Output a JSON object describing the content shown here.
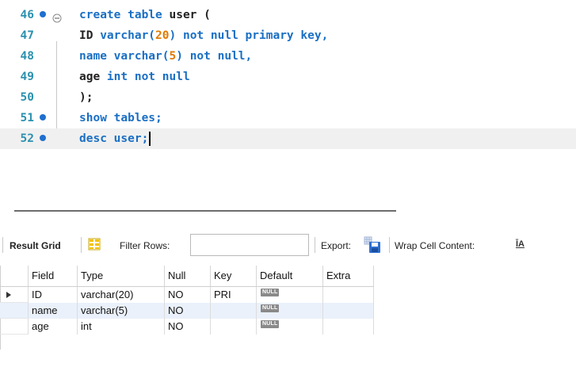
{
  "editor": {
    "lines": [
      {
        "num": "46",
        "dot": true,
        "fold": true,
        "tokens": [
          {
            "t": "create table",
            "c": "kw"
          },
          {
            "t": " user (",
            "c": "id"
          }
        ]
      },
      {
        "num": "47",
        "dot": false,
        "fold": false,
        "tokens": [
          {
            "t": "ID ",
            "c": "id"
          },
          {
            "t": "varchar(",
            "c": "kw"
          },
          {
            "t": "20",
            "c": "num"
          },
          {
            "t": ") not null primary key,",
            "c": "kw"
          }
        ]
      },
      {
        "num": "48",
        "dot": false,
        "fold": false,
        "tokens": [
          {
            "t": "name varchar(",
            "c": "kw"
          },
          {
            "t": "5",
            "c": "num"
          },
          {
            "t": ") not null,",
            "c": "kw"
          }
        ]
      },
      {
        "num": "49",
        "dot": false,
        "fold": false,
        "tokens": [
          {
            "t": "age ",
            "c": "id"
          },
          {
            "t": "int not null",
            "c": "kw"
          }
        ]
      },
      {
        "num": "50",
        "dot": false,
        "fold": false,
        "tokens": [
          {
            "t": ");",
            "c": "id"
          }
        ]
      },
      {
        "num": "51",
        "dot": true,
        "fold": false,
        "tokens": [
          {
            "t": "show tables;",
            "c": "kw"
          }
        ]
      },
      {
        "num": "52",
        "dot": true,
        "fold": false,
        "tokens": [
          {
            "t": "desc user;",
            "c": "kw"
          }
        ]
      }
    ]
  },
  "toolbar": {
    "result_grid_label": "Result Grid",
    "filter_rows_label": "Filter Rows:",
    "filter_value": "",
    "export_label": "Export:",
    "wrap_label": "Wrap Cell Content:",
    "wrap_icon_glyph": "ĪA"
  },
  "grid": {
    "columns": [
      "Field",
      "Type",
      "Null",
      "Key",
      "Default",
      "Extra"
    ],
    "null_badge": "NULL",
    "rows": [
      {
        "field": "ID",
        "type": "varchar(20)",
        "null": "NO",
        "key": "PRI",
        "default": "NULL",
        "extra": "",
        "current": true
      },
      {
        "field": "name",
        "type": "varchar(5)",
        "null": "NO",
        "key": "",
        "default": "NULL",
        "extra": "",
        "current": false
      },
      {
        "field": "age",
        "type": "int",
        "null": "NO",
        "key": "",
        "default": "NULL",
        "extra": "",
        "current": false
      }
    ]
  },
  "colors": {
    "keyword": "#1a6fc4",
    "number": "#e07a00",
    "line_number": "#2b91af",
    "statement_dot": "#1e6fcf"
  }
}
